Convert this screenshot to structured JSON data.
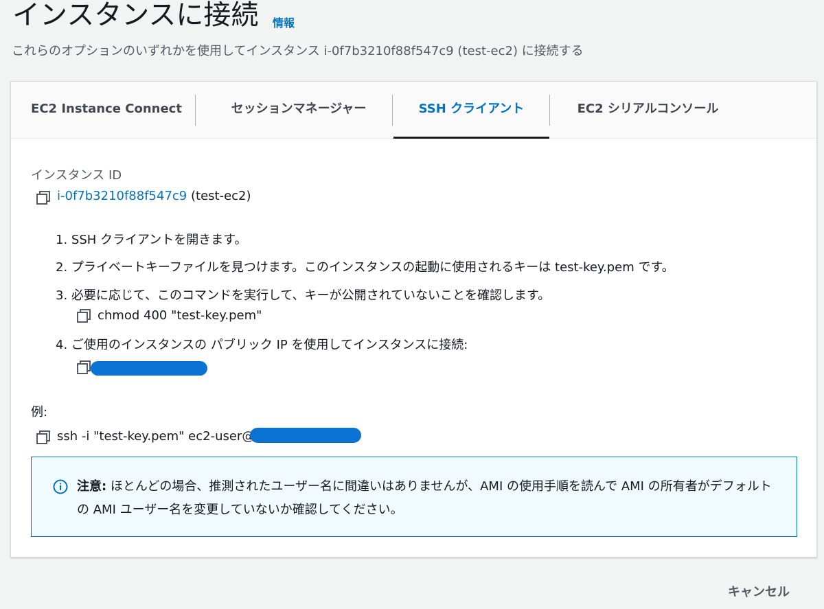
{
  "header": {
    "title": "インスタンスに接続",
    "info_link": "情報",
    "subtitle": "これらのオプションのいずれかを使用してインスタンス i-0f7b3210f88f547c9 (test-ec2) に接続する"
  },
  "tabs": [
    {
      "label": "EC2 Instance Connect",
      "active": false
    },
    {
      "label": "セッションマネージャー",
      "active": false
    },
    {
      "label": "SSH クライアント",
      "active": true
    },
    {
      "label": "EC2 シリアルコンソール",
      "active": false
    }
  ],
  "instance": {
    "label": "インスタンス ID",
    "id": "i-0f7b3210f88f547c9",
    "name": "(test-ec2)"
  },
  "steps": [
    "1. SSH クライアントを開きます。",
    "2. プライベートキーファイルを見つけます。このインスタンスの起動に使用されるキーは test-key.pem です。",
    "3. 必要に応じて、このコマンドを実行して、キーが公開されていないことを確認します。",
    "4. ご使用のインスタンスの パブリック IP を使用してインスタンスに接続:"
  ],
  "chmod_command": "chmod 400 \"test-key.pem\"",
  "example": {
    "label": "例:",
    "command": "ssh -i \"test-key.pem\" ec2-user@"
  },
  "alert": {
    "bold": "注意:",
    "text": " ほとんどの場合、推測されたユーザー名に間違いはありませんが、AMI の使用手順を読んで AMI の所有者がデフォルトの AMI ユーザー名を変更していないか確認してください。"
  },
  "footer": {
    "cancel_label": "キャンセル"
  },
  "colors": {
    "link": "#0073bb",
    "redaction": "#0972d3",
    "alert_bg": "#f1faff",
    "alert_border": "#0073bb"
  },
  "icons": [
    "copy-icon",
    "info-circle-icon"
  ]
}
